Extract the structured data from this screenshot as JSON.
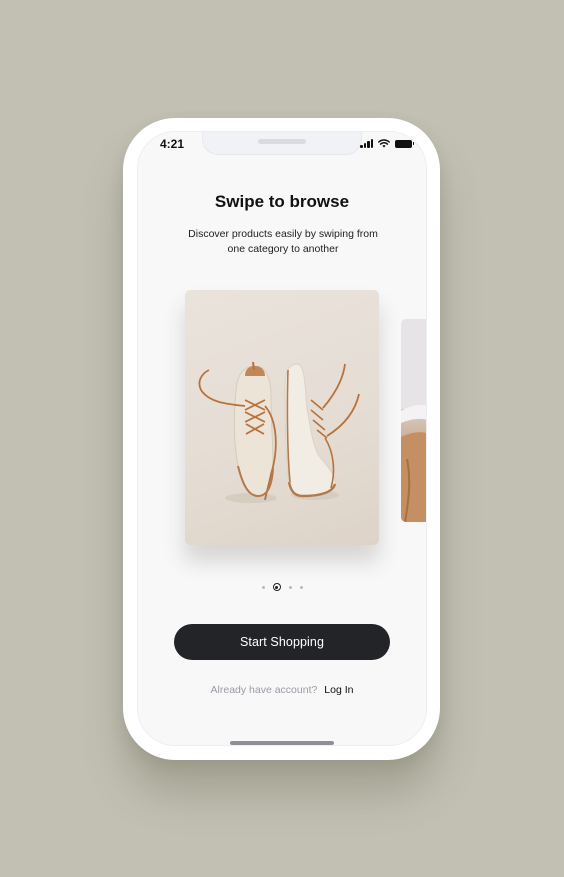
{
  "status_bar": {
    "time": "4:21",
    "icons": [
      "signal-icon",
      "wifi-icon",
      "battery-icon"
    ]
  },
  "onboarding": {
    "title": "Swipe to browse",
    "subtitle": "Discover products easily by swiping from one category to another"
  },
  "carousel": {
    "cards": [
      {
        "image": "sneakers-photo",
        "state": "current"
      },
      {
        "image": "person-photo",
        "state": "next-peek"
      }
    ],
    "page_indicator": {
      "total": 4,
      "active_index": 1
    }
  },
  "actions": {
    "start_label": "Start Shopping",
    "login_prompt": "Already have account?",
    "login_link": "Log In"
  },
  "colors": {
    "background": "#c1c0b3",
    "button": "#232428",
    "muted_text": "#9a9ca3"
  }
}
